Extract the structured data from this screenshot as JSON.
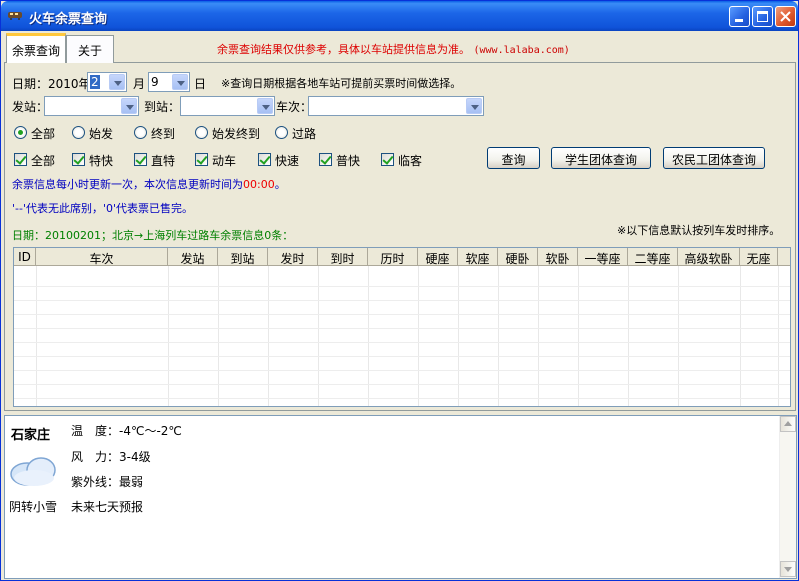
{
  "window": {
    "title": "火车余票查询"
  },
  "tabs": [
    {
      "label": "余票查询"
    },
    {
      "label": "关于"
    }
  ],
  "notice": {
    "text": "余票查询结果仅供参考，具体以车站提供信息为准。",
    "url": "(www.lalaba.com)"
  },
  "query": {
    "date_label": "日期：2010年",
    "month_value": "2",
    "month_label": "月",
    "day_value": "9",
    "day_label": "日",
    "date_hint": "※查询日期根据各地车站可提前买票时间做选择。",
    "from_label": "发站：",
    "to_label": "到站：",
    "train_label": "车次："
  },
  "radios": [
    {
      "label": "全部",
      "checked": true
    },
    {
      "label": "始发",
      "checked": false
    },
    {
      "label": "终到",
      "checked": false
    },
    {
      "label": "始发终到",
      "checked": false
    },
    {
      "label": "过路",
      "checked": false
    }
  ],
  "checkboxes": [
    {
      "label": "全部",
      "checked": true
    },
    {
      "label": "特快",
      "checked": true
    },
    {
      "label": "直特",
      "checked": true
    },
    {
      "label": "动车",
      "checked": true
    },
    {
      "label": "快速",
      "checked": true
    },
    {
      "label": "普快",
      "checked": true
    },
    {
      "label": "临客",
      "checked": true
    }
  ],
  "buttons": {
    "query": "查询",
    "student": "学生团体查询",
    "worker": "农民工团体查询"
  },
  "info": {
    "update_text": "余票信息每小时更新一次，本次信息更新时间为",
    "update_time": "00:00",
    "update_end": "。",
    "legend_text": "'--'代表无此席别，'0'代表票已售完。",
    "result_text": "日期：20100201；北京→上海列车过路车余票信息0条：",
    "sort_text": "※以下信息默认按列车发时排序。"
  },
  "grid": {
    "columns": [
      "ID",
      "车次",
      "发站",
      "到站",
      "发时",
      "到时",
      "历时",
      "硬座",
      "软座",
      "硬卧",
      "软卧",
      "一等座",
      "二等座",
      "高级软卧",
      "无座"
    ]
  },
  "weather": {
    "city": "石家庄",
    "temperature": "温　度：-4℃～-2℃",
    "wind": "风　力：3-4级",
    "uv": "紫外线：最弱",
    "condition": "阴转小雪",
    "forecast": "未来七天预报"
  }
}
